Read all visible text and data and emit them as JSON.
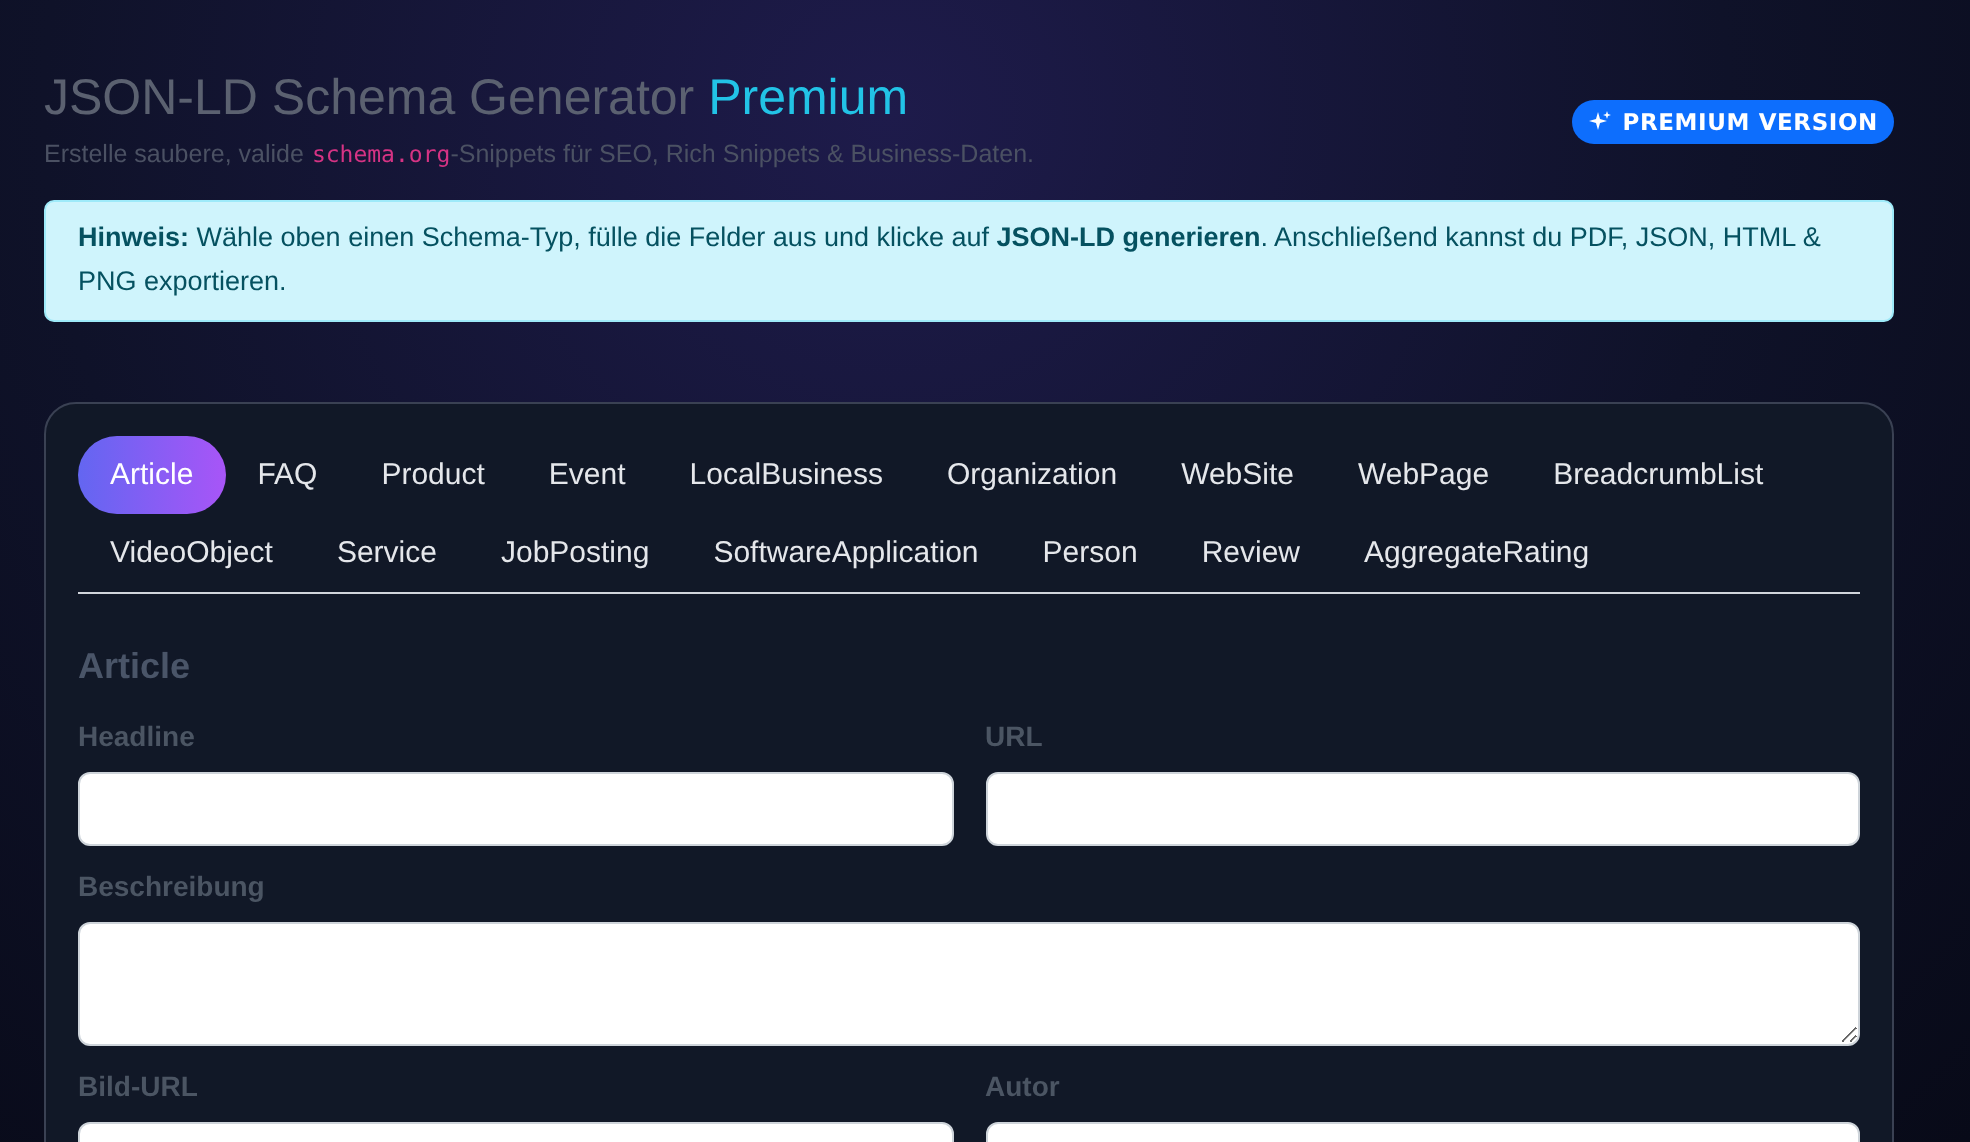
{
  "header": {
    "title": "JSON-LD Schema Generator",
    "title_accent": "Premium",
    "subtitle": [
      {
        "kind": "text",
        "text": "Erstelle saubere, valide"
      },
      {
        "kind": "code",
        "text": "schema.org"
      },
      {
        "kind": "text",
        "text": "-Snippets für SEO, Rich Snippets & Business-Daten."
      }
    ],
    "badge": "PREMIUM VERSION"
  },
  "notice": "**Hinweis:** Wähle oben einen Schema-Typ, fülle die Felder aus und klicke auf **JSON-LD generieren**. Anschließend kannst du PDF, JSON, HTML & PNG exportieren.",
  "tabs": [
    {
      "label": "Article",
      "selected": true
    },
    {
      "label": "FAQ",
      "selected": false
    },
    {
      "label": "Product",
      "selected": false
    },
    {
      "label": "Event",
      "selected": false
    },
    {
      "label": "LocalBusiness",
      "selected": false
    },
    {
      "label": "Organization",
      "selected": false
    },
    {
      "label": "WebSite",
      "selected": false
    },
    {
      "label": "WebPage",
      "selected": false
    },
    {
      "label": "BreadcrumbList",
      "selected": false
    },
    {
      "label": "VideoObject",
      "selected": false
    },
    {
      "label": "Service",
      "selected": false
    },
    {
      "label": "JobPosting",
      "selected": false
    },
    {
      "label": "SoftwareApplication",
      "selected": false
    },
    {
      "label": "Person",
      "selected": false
    },
    {
      "label": "Review",
      "selected": false
    },
    {
      "label": "AggregateRating",
      "selected": false
    }
  ],
  "form": {
    "title": "Article",
    "fields": [
      {
        "label": "Headline",
        "kind": "input"
      },
      {
        "label": "URL",
        "kind": "input"
      },
      {
        "label": "Beschreibung",
        "kind": "textarea"
      },
      {
        "label": "Bild-URL",
        "kind": "input"
      },
      {
        "label": "Autor",
        "kind": "input"
      }
    ]
  }
}
